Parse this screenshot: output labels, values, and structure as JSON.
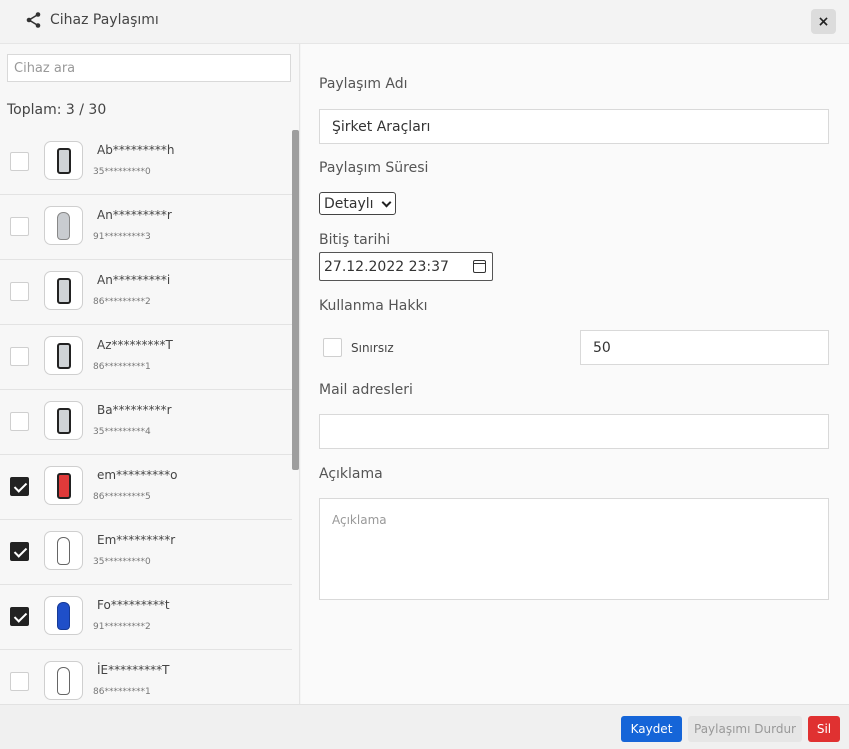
{
  "header": {
    "title": "Cihaz Paylaşımı",
    "close_label": "×"
  },
  "left": {
    "search_placeholder": "Cihaz ara",
    "total": "Toplam: 3 / 30",
    "items": [
      {
        "name": "Ab*********h",
        "sub": "35*********0",
        "checked": false,
        "icon": "phone-icon"
      },
      {
        "name": "An*********r",
        "sub": "91*********3",
        "checked": false,
        "icon": "car-icon"
      },
      {
        "name": "An*********i",
        "sub": "86*********2",
        "checked": false,
        "icon": "phone-icon"
      },
      {
        "name": "Az*********T",
        "sub": "86*********1",
        "checked": false,
        "icon": "phone-icon"
      },
      {
        "name": "Ba*********r",
        "sub": "35*********4",
        "checked": false,
        "icon": "phone-icon"
      },
      {
        "name": "em*********o",
        "sub": "86*********5",
        "checked": true,
        "icon": "phone-icon"
      },
      {
        "name": "Em*********r",
        "sub": "35*********0",
        "checked": true,
        "icon": "car-icon"
      },
      {
        "name": "Fo*********t",
        "sub": "91*********2",
        "checked": true,
        "icon": "car-icon"
      },
      {
        "name": "İE*********T",
        "sub": "86*********1",
        "checked": false,
        "icon": "car-icon"
      }
    ]
  },
  "form": {
    "name_label": "Paylaşım Adı",
    "name_value": "Şirket Araçları",
    "duration_label": "Paylaşım Süresi",
    "duration_value": "Detaylı",
    "end_date_label": "Bitiş tarihi",
    "end_date_value": "27.12.2022  23:37",
    "usage_label": "Kullanma Hakkı",
    "unlimited_label": "Sınırsız",
    "usage_value": "50",
    "mail_label": "Mail adresleri",
    "mail_value": "",
    "desc_label": "Açıklama",
    "desc_placeholder": "Açıklama"
  },
  "footer": {
    "save": "Kaydet",
    "stop": "Paylaşımı Durdur",
    "delete": "Sil"
  },
  "colors": {
    "primary": "#1565d8",
    "danger": "#e03131"
  }
}
